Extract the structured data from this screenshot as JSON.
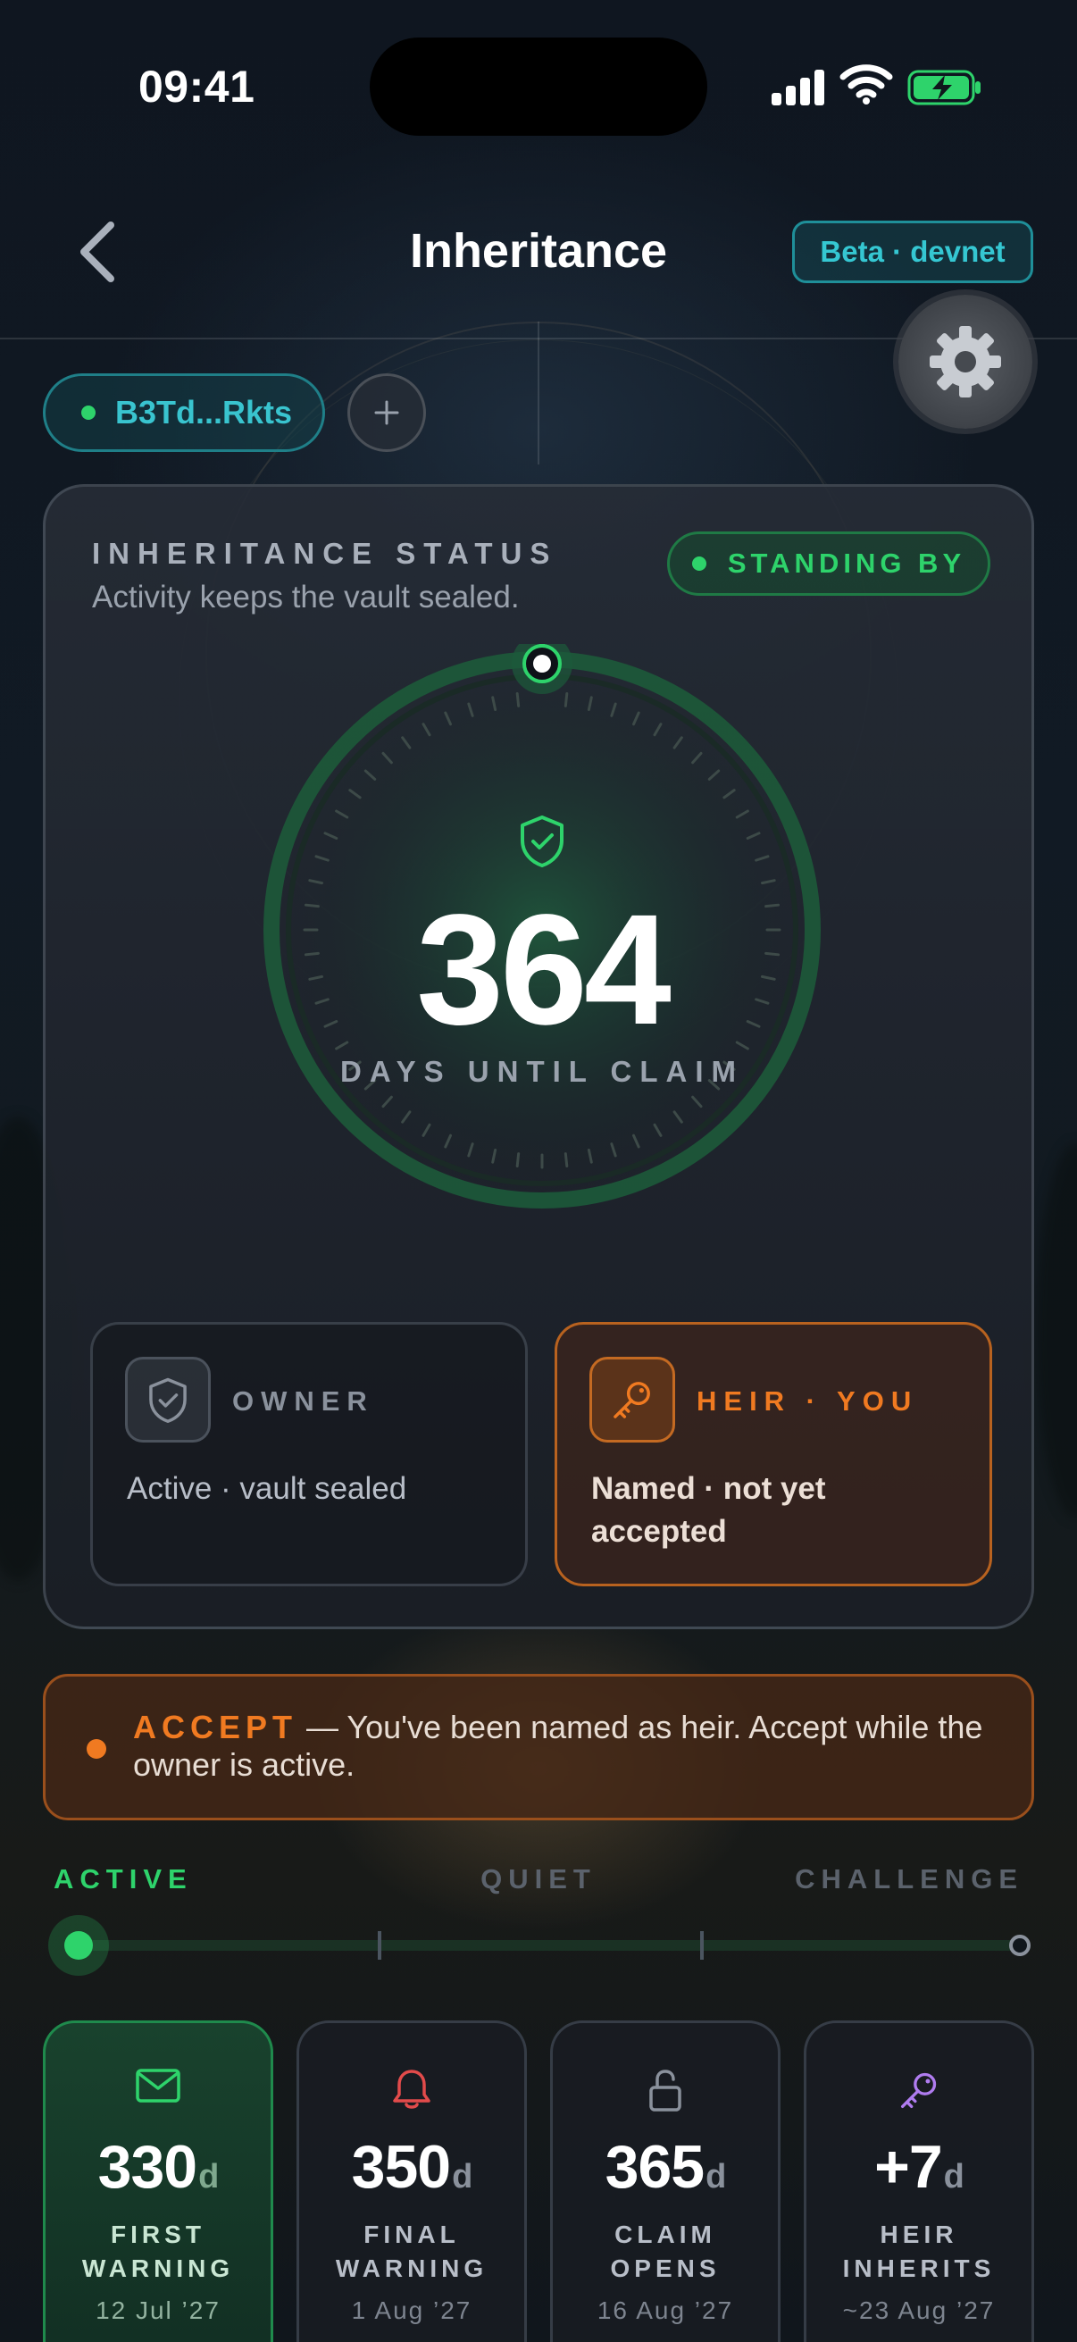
{
  "status_bar": {
    "time": "09:41"
  },
  "nav": {
    "title": "Inheritance",
    "badge": "Beta · devnet"
  },
  "wallet": {
    "label": "B3Td...Rkts",
    "add_label": "+"
  },
  "status_card": {
    "title": "INHERITANCE STATUS",
    "subtitle": "Activity keeps the vault sealed.",
    "state_badge": "STANDING BY",
    "countdown_value": "364",
    "countdown_label": "DAYS UNTIL CLAIM"
  },
  "roles": {
    "owner": {
      "label": "OWNER",
      "description": "Active · vault sealed"
    },
    "heir": {
      "label": "HEIR · YOU",
      "description": "Named · not yet accepted"
    }
  },
  "accept_banner": {
    "keyword": "ACCEPT",
    "separator": "—",
    "message": "You've been named as heir. Accept while the owner is active."
  },
  "phases": [
    "ACTIVE",
    "QUIET",
    "CHALLENGE"
  ],
  "milestones": [
    {
      "icon": "envelope-icon",
      "value": "330",
      "unit": "d",
      "label": "FIRST\nWARNING",
      "date": "12 Jul ’27",
      "active": true
    },
    {
      "icon": "bell-icon",
      "value": "350",
      "unit": "d",
      "label": "FINAL\nWARNING",
      "date": "1 Aug ’27",
      "active": false
    },
    {
      "icon": "unlock-icon",
      "value": "365",
      "unit": "d",
      "label": "CLAIM\nOPENS",
      "date": "16 Aug ’27",
      "active": false
    },
    {
      "icon": "key-icon",
      "value": "+7",
      "unit": "d",
      "label": "HEIR\nINHERITS",
      "date": "~23 Aug ’27",
      "active": false
    }
  ],
  "colors": {
    "accent_green": "#2ed36b",
    "accent_orange": "#f07a21",
    "accent_teal": "#35c7d2",
    "alert_red": "#e24b4b",
    "heir_purple": "#b07cf0"
  }
}
